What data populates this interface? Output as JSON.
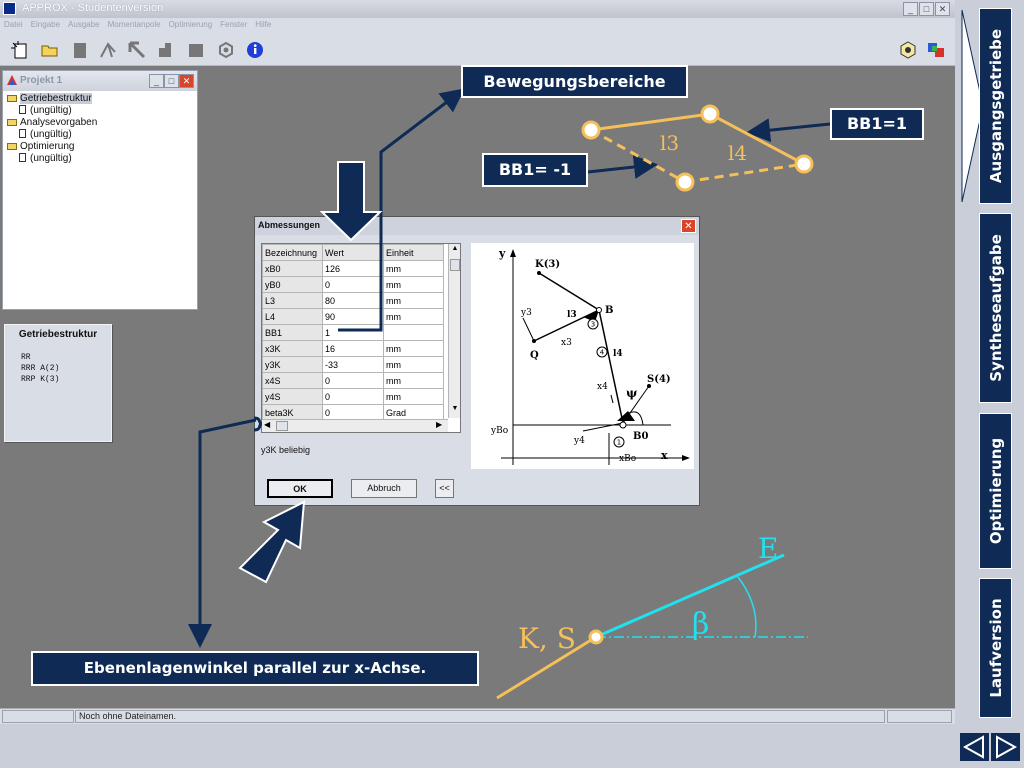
{
  "window": {
    "title": "APPROX - Studentenversion",
    "minimize": "_",
    "maximize": "□",
    "close": "✕"
  },
  "menu": [
    "Datei",
    "Eingabe",
    "Ausgabe",
    "Momentanpole",
    "Optimierung",
    "Fenster",
    "Hilfe"
  ],
  "project": {
    "title": "Projekt 1",
    "tree": [
      {
        "label": "Getriebestruktur",
        "child": "(ungültig)"
      },
      {
        "label": "Analysevorgaben",
        "child": "(ungültig)"
      },
      {
        "label": "Optimierung",
        "child": "(ungültig)"
      }
    ]
  },
  "structure_panel": {
    "title": "Getriebestruktur",
    "lines": [
      "RR",
      "RRR A(2)",
      "RRP K(3)"
    ]
  },
  "dialog": {
    "title": "Abmessungen",
    "columns": [
      "Bezeichnung",
      "Wert",
      "Einheit"
    ],
    "rows": [
      [
        "xB0",
        "126",
        "mm"
      ],
      [
        "yB0",
        "0",
        "mm"
      ],
      [
        "L3",
        "80",
        "mm"
      ],
      [
        "L4",
        "90",
        "mm"
      ],
      [
        "BB1",
        "1",
        ""
      ],
      [
        "x3K",
        "16",
        "mm"
      ],
      [
        "y3K",
        "-33",
        "mm"
      ],
      [
        "x4S",
        "0",
        "mm"
      ],
      [
        "y4S",
        "0",
        "mm"
      ],
      [
        "beta3K",
        "0",
        "Grad"
      ]
    ],
    "note": "y3K beliebig",
    "ok_label": "OK",
    "cancel_label": "Abbruch",
    "back_label": "<<",
    "close_label": "✕"
  },
  "diagram": {
    "axis_x": "x",
    "axis_y": "y",
    "labels": [
      "K(3)",
      "B",
      "Q",
      "S(4)",
      "B0",
      "ψ"
    ],
    "sub_labels": [
      "y3",
      "x3",
      "l3",
      "l4",
      "x4",
      "y4",
      "yBo",
      "xBo"
    ],
    "joint_numbers": [
      "1",
      "3",
      "4"
    ]
  },
  "status": {
    "text": "Noch ohne Dateinamen."
  },
  "callouts": {
    "bewegungsbereiche": "Bewegungsbereiche",
    "bb1_pos": "BB1=1",
    "bb1_neg": "BB1= -1",
    "ebenenlage": "Ebenenlagenwinkel parallel zur x-Achse."
  },
  "sketch": {
    "l3": "l3",
    "l4": "l4",
    "ks": "K, S",
    "e": "E",
    "beta": "β"
  },
  "sidenav": {
    "items": [
      "Ausgangsgetriebe",
      "Syntheseaufgabe",
      "Optimierung",
      "Laufversion"
    ],
    "prev": "◁",
    "next": "▷"
  },
  "colors": {
    "navy": "#0e2a55",
    "workspace": "#7a7a7a",
    "orange": "#f5bf5a",
    "cyan": "#22e0ee",
    "chrome": "#d9dde5"
  }
}
